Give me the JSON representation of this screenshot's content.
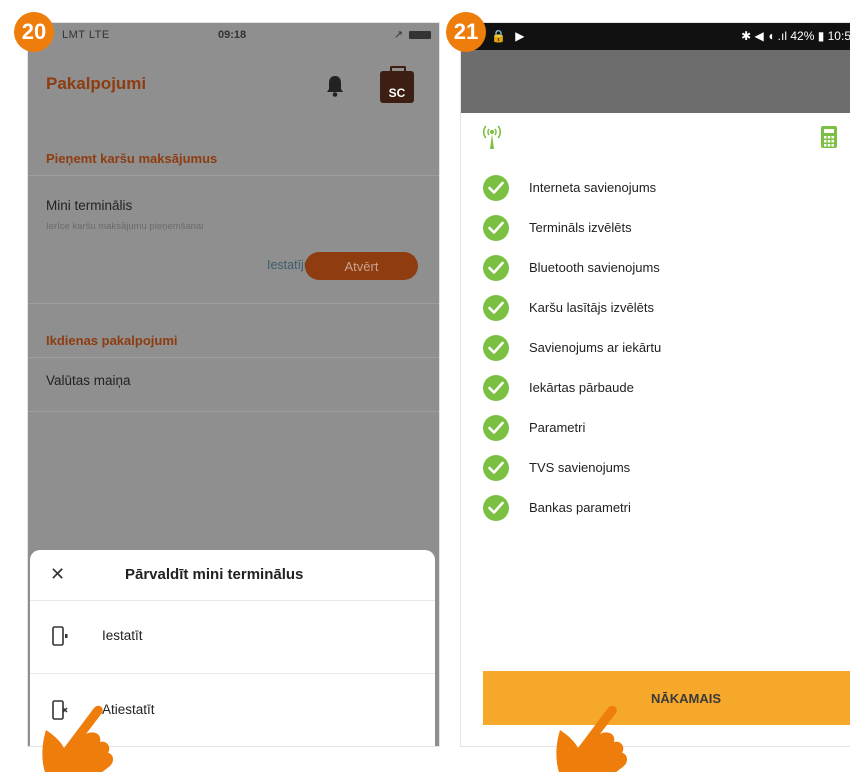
{
  "steps": {
    "left": "20",
    "right": "21"
  },
  "left_screen": {
    "status": {
      "carrier": "LMT  LTE",
      "time": "09:18",
      "location": "↗"
    },
    "title": "Pakalpojumi",
    "avatar_label": "SC",
    "section_card": {
      "title": "Pieņemt karšu maksājumus"
    },
    "mini_terminal": {
      "title": "Mini terminālis",
      "subtitle": "Ierīce karšu maksājumu pieņemšanai",
      "settings_link": "Iestatījumi",
      "open_button": "Atvērt"
    },
    "section_daily": {
      "title": "Ikdienas pakalpojumi"
    },
    "currency_item": "Valūtas maiņa",
    "sheet": {
      "title": "Pārvaldīt mini terminālus",
      "items": [
        {
          "label": "Iestatīt",
          "icon": "phone-setup-icon"
        },
        {
          "label": "Atiestatīt",
          "icon": "phone-reset-icon"
        }
      ]
    }
  },
  "right_screen": {
    "status": {
      "left": "🔒 ▶",
      "right": "✱ ◀ ◖ .ıl 42% ▮ 10:5"
    },
    "checks": [
      "Interneta savienojums",
      "Termināls izvēlēts",
      "Bluetooth savienojums",
      "Karšu lasītājs izvēlēts",
      "Savienojums ar iekārtu",
      "Iekārtas pārbaude",
      "Parametri",
      "TVS savienojums",
      "Bankas parametri"
    ],
    "next_button": "NĀKAMAIS"
  },
  "colors": {
    "accent": "#ee7d0c",
    "brand_brown": "#8e3c10",
    "check_green": "#7cc043",
    "next_orange": "#f5a82a"
  }
}
